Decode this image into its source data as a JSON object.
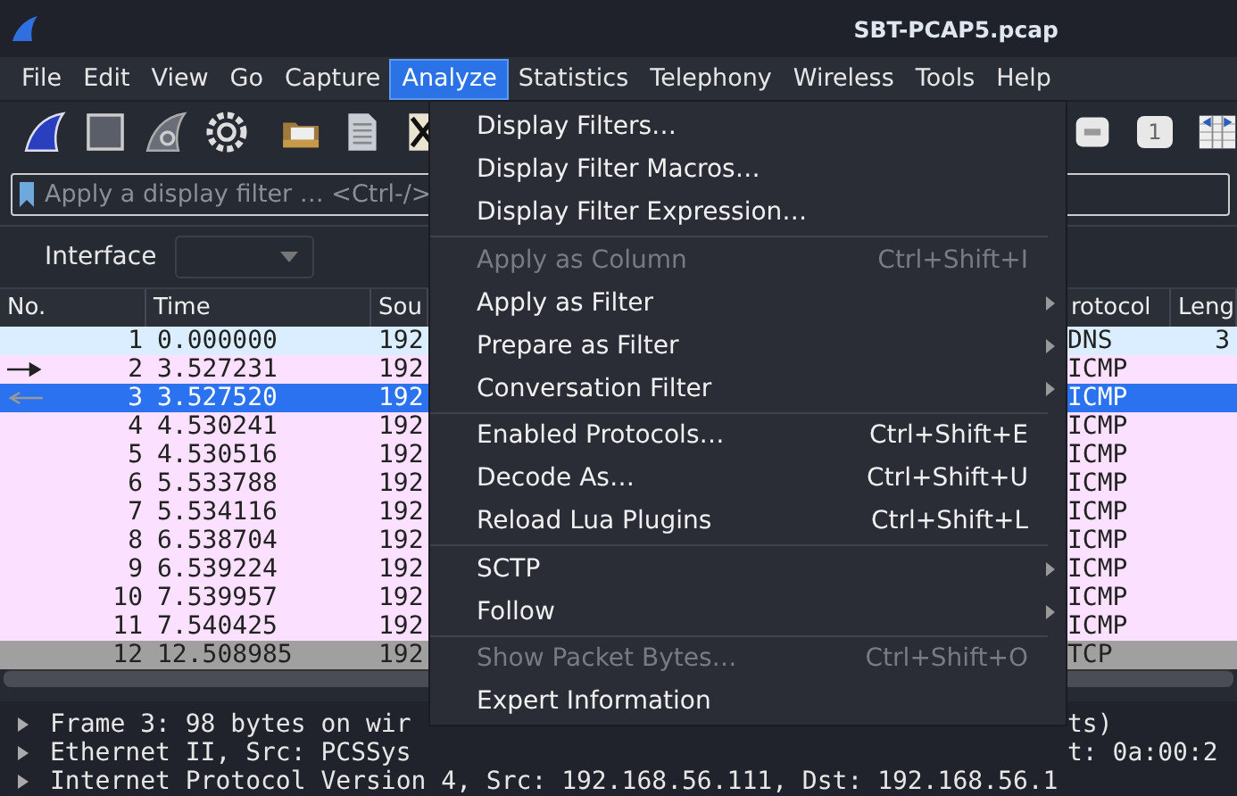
{
  "window": {
    "title": "SBT-PCAP5.pcap"
  },
  "menubar": [
    {
      "label": "File",
      "selected": false
    },
    {
      "label": "Edit",
      "selected": false
    },
    {
      "label": "View",
      "selected": false
    },
    {
      "label": "Go",
      "selected": false
    },
    {
      "label": "Capture",
      "selected": false
    },
    {
      "label": "Analyze",
      "selected": true
    },
    {
      "label": "Statistics",
      "selected": false
    },
    {
      "label": "Telephony",
      "selected": false
    },
    {
      "label": "Wireless",
      "selected": false
    },
    {
      "label": "Tools",
      "selected": false
    },
    {
      "label": "Help",
      "selected": false
    }
  ],
  "toolbar": {
    "zoom_reset_label": "1"
  },
  "filter_bar": {
    "placeholder": "Apply a display filter … <Ctrl-/>"
  },
  "interface_bar": {
    "label": "Interface"
  },
  "packet_list": {
    "columns": [
      "No.",
      "Time",
      "Sou",
      "rotocol",
      "Leng"
    ],
    "rows": [
      {
        "no": "1",
        "time": "0.000000",
        "source": "192",
        "protocol": "DNS",
        "length": "3",
        "color": "#daeeff",
        "selected": false
      },
      {
        "no": "2",
        "time": "3.527231",
        "source": "192",
        "protocol": "ICMP",
        "color": "#fce0ff",
        "selected": false,
        "kind": "request"
      },
      {
        "no": "3",
        "time": "3.527520",
        "source": "192",
        "protocol": "ICMP",
        "selected": true,
        "kind": "response"
      },
      {
        "no": "4",
        "time": "4.530241",
        "source": "192",
        "protocol": "ICMP",
        "color": "#fce0ff",
        "selected": false
      },
      {
        "no": "5",
        "time": "4.530516",
        "source": "192",
        "protocol": "ICMP",
        "color": "#fce0ff",
        "selected": false
      },
      {
        "no": "6",
        "time": "5.533788",
        "source": "192",
        "protocol": "ICMP",
        "color": "#fce0ff",
        "selected": false
      },
      {
        "no": "7",
        "time": "5.534116",
        "source": "192",
        "protocol": "ICMP",
        "color": "#fce0ff",
        "selected": false
      },
      {
        "no": "8",
        "time": "6.538704",
        "source": "192",
        "protocol": "ICMP",
        "color": "#fce0ff",
        "selected": false
      },
      {
        "no": "9",
        "time": "6.539224",
        "source": "192",
        "protocol": "ICMP",
        "color": "#fce0ff",
        "selected": false
      },
      {
        "no": "10",
        "time": "7.539957",
        "source": "192",
        "protocol": "ICMP",
        "color": "#fce0ff",
        "selected": false
      },
      {
        "no": "11",
        "time": "7.540425",
        "source": "192",
        "protocol": "ICMP",
        "color": "#fce0ff",
        "selected": false
      },
      {
        "no": "12",
        "time": "12.508985",
        "source": "192",
        "protocol": "TCP",
        "color": "#a0a0a0",
        "selected": false
      }
    ]
  },
  "details": [
    {
      "left": "Frame 3: 98 bytes on wir",
      "right": "ts)"
    },
    {
      "left": "Ethernet II, Src: PCSSys",
      "right": "t: 0a:00:2"
    },
    {
      "left": "Internet Protocol Version 4, Src: 192.168.56.111, Dst: 192.168.56.1"
    }
  ],
  "analyze_menu": {
    "sections": [
      [
        {
          "label": "Display Filters…",
          "disabled": false,
          "submenu": false
        },
        {
          "label": "Display Filter Macros…",
          "disabled": false,
          "submenu": false
        },
        {
          "label": "Display Filter Expression…",
          "disabled": false,
          "submenu": false
        }
      ],
      [
        {
          "label": "Apply as Column",
          "shortcut": "Ctrl+Shift+I",
          "disabled": true,
          "submenu": false
        },
        {
          "label": "Apply as Filter",
          "disabled": false,
          "submenu": true
        },
        {
          "label": "Prepare as Filter",
          "disabled": false,
          "submenu": true
        },
        {
          "label": "Conversation Filter",
          "disabled": false,
          "submenu": true
        }
      ],
      [
        {
          "label": "Enabled Protocols…",
          "shortcut": "Ctrl+Shift+E",
          "disabled": false,
          "submenu": false
        },
        {
          "label": "Decode As…",
          "shortcut": "Ctrl+Shift+U",
          "disabled": false,
          "submenu": false
        },
        {
          "label": "Reload Lua Plugins",
          "shortcut": "Ctrl+Shift+L",
          "disabled": false,
          "submenu": false
        }
      ],
      [
        {
          "label": "SCTP",
          "disabled": false,
          "submenu": true
        },
        {
          "label": "Follow",
          "disabled": false,
          "submenu": true
        }
      ],
      [
        {
          "label": "Show Packet Bytes…",
          "shortcut": "Ctrl+Shift+O",
          "disabled": true,
          "submenu": false
        },
        {
          "label": "Expert Information",
          "disabled": false,
          "submenu": false
        }
      ]
    ]
  }
}
